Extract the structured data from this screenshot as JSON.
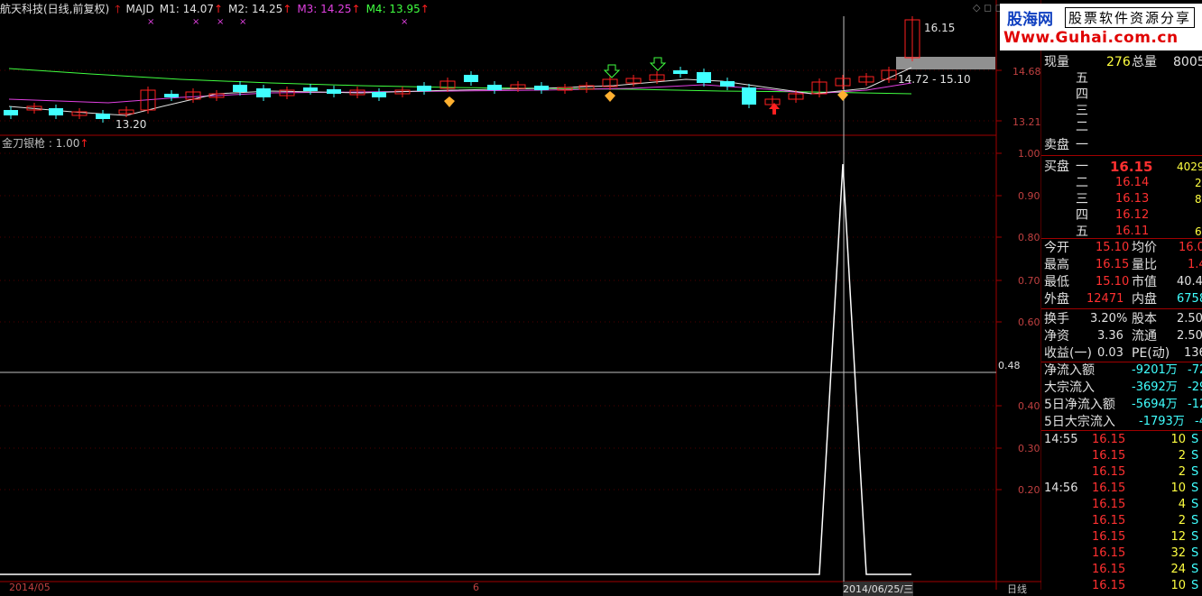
{
  "header": {
    "stock_title": "航天科技(日线,前复权)",
    "indicator_name": "MAJD",
    "m1": "M1: 14.07",
    "m2": "M2: 14.25",
    "m3": "M3: 14.25",
    "m4": "M4: 13.95",
    "corner_icons": "◇ ◻ ◻"
  },
  "colors": {
    "m1": "#e0e0e0",
    "m2": "#e0e0e0",
    "m3": "#e040e0",
    "m4": "#40ff40",
    "up_candle": "#ff2020",
    "down_candle": "#40ffff"
  },
  "price_chart": {
    "high_label": "16.15",
    "low_label": "13.20",
    "range_label": "14.72 - 15.10",
    "axis_labels": [
      "14.68",
      "13.21"
    ]
  },
  "indicator": {
    "title": "金刀银枪 : 1.00",
    "axis_labels": [
      "1.00",
      "0.90",
      "0.80",
      "0.70",
      "0.60",
      "0.48",
      "0.40",
      "0.30",
      "0.20"
    ],
    "crosshair_value": "0.48"
  },
  "bottom": {
    "left_date": "2014/05",
    "mid_mark": "6",
    "right_date": "2014/06/25/三",
    "period": "日线"
  },
  "logo": {
    "site_cn": "股海网",
    "slogan": "股票软件资源分享",
    "url": "Www.Guhai.com.cn"
  },
  "quote": {
    "xianliang_label": "现量",
    "xianliang": "276",
    "zongliang_label": "总量",
    "zongliang": "8005",
    "sell_label": "卖盘",
    "buy_label": "买盘",
    "sell_levels": [
      "五",
      "四",
      "三",
      "二",
      "一"
    ],
    "buy_levels": [
      {
        "level": "一",
        "price": "16.15",
        "vol": "4029"
      },
      {
        "level": "二",
        "price": "16.14",
        "vol": "2"
      },
      {
        "level": "三",
        "price": "16.13",
        "vol": "8"
      },
      {
        "level": "四",
        "price": "16.12",
        "vol": ""
      },
      {
        "level": "五",
        "price": "16.11",
        "vol": "6"
      }
    ],
    "stats": [
      {
        "l1": "今开",
        "v1": "15.10",
        "l2": "均价",
        "v2": "16.0"
      },
      {
        "l1": "最高",
        "v1": "16.15",
        "l2": "量比",
        "v2": "1.4"
      },
      {
        "l1": "最低",
        "v1": "15.10",
        "l2": "市值",
        "v2": "40.4"
      },
      {
        "l1": "外盘",
        "v1": "12471",
        "l2": "内盘",
        "v2": "6758"
      }
    ],
    "stats2": [
      {
        "l1": "换手",
        "v1": "3.20%",
        "l2": "股本",
        "v2": "2.50"
      },
      {
        "l1": "净资",
        "v1": "3.36",
        "l2": "流通",
        "v2": "2.50"
      },
      {
        "l1": "收益(一)",
        "v1": "0.03",
        "l2": "PE(动)",
        "v2": "136"
      }
    ],
    "flows": [
      {
        "label": "净流入额",
        "v1": "-9201万",
        "v2": "-72"
      },
      {
        "label": "大宗流入",
        "v1": "-3692万",
        "v2": "-29"
      },
      {
        "label": "5日净流入额",
        "v1": "-5694万",
        "v2": "-12"
      },
      {
        "label": "5日大宗流入",
        "v1": "-1793万",
        "v2": "-4"
      }
    ],
    "ticks": [
      {
        "time": "14:55",
        "price": "16.15",
        "vol": "10",
        "side": "S"
      },
      {
        "time": "",
        "price": "16.15",
        "vol": "2",
        "side": "S"
      },
      {
        "time": "",
        "price": "16.15",
        "vol": "2",
        "side": "S"
      },
      {
        "time": "14:56",
        "price": "16.15",
        "vol": "10",
        "side": "S"
      },
      {
        "time": "",
        "price": "16.15",
        "vol": "4",
        "side": "S"
      },
      {
        "time": "",
        "price": "16.15",
        "vol": "2",
        "side": "S"
      },
      {
        "time": "",
        "price": "16.15",
        "vol": "12",
        "side": "S"
      },
      {
        "time": "",
        "price": "16.15",
        "vol": "32",
        "side": "S"
      },
      {
        "time": "",
        "price": "16.15",
        "vol": "24",
        "side": "S"
      },
      {
        "time": "",
        "price": "16.15",
        "vol": "10",
        "side": "S"
      }
    ]
  }
}
